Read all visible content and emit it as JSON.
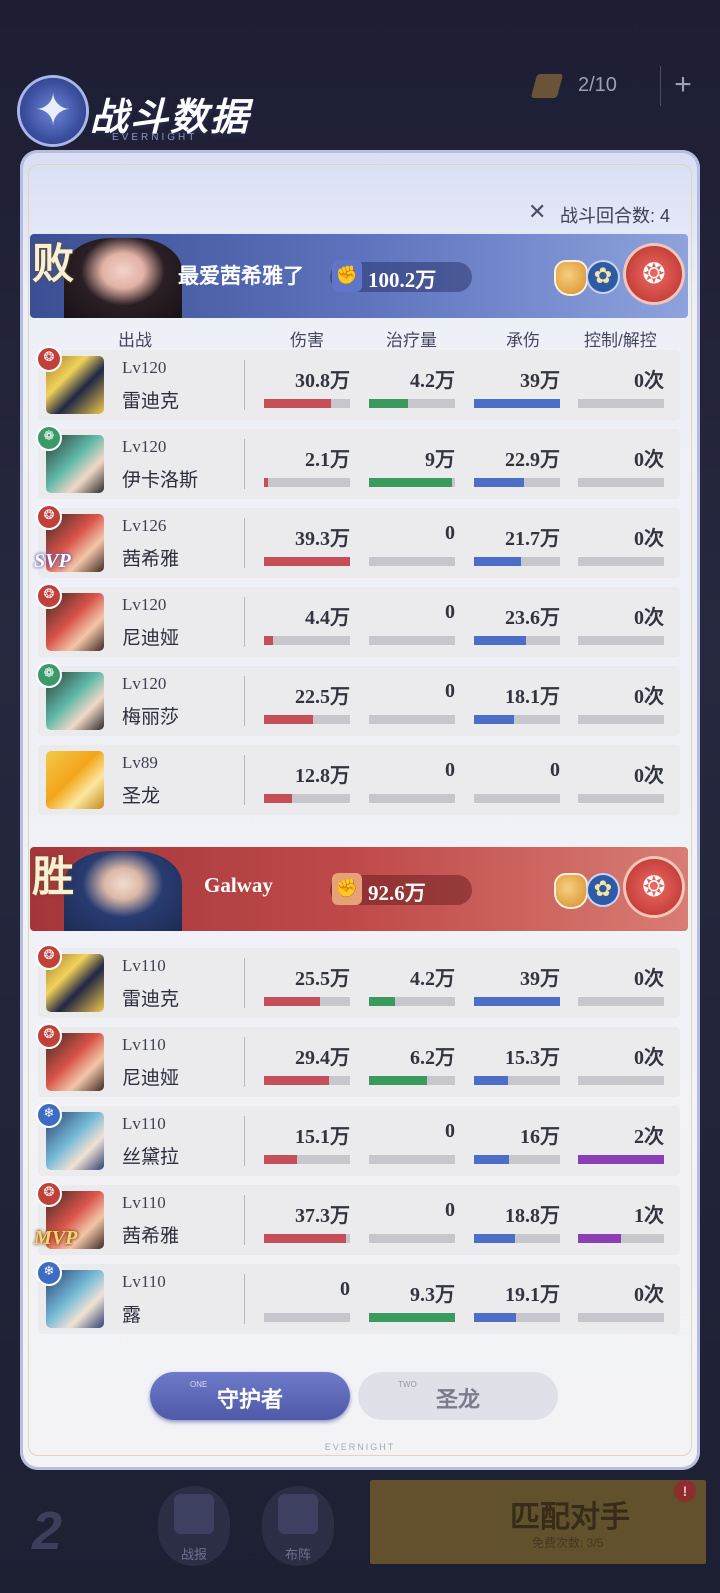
{
  "topbar": {
    "ticket_count": "2/10",
    "plus": "+"
  },
  "header": {
    "title": "战斗数据",
    "brand": "EVERNIGHT",
    "rounds_label": "战斗回合数: 4",
    "rounds_icon": "✕"
  },
  "emblem_glyph": "✦",
  "columns": {
    "lineup": "出战",
    "damage": "伤害",
    "heal": "治疗量",
    "tank": "承伤",
    "control": "控制/解控"
  },
  "team_lose": {
    "result": "败",
    "name": "最爱茜希雅了",
    "power": "100.2万",
    "power_icon": "✊",
    "flower": "✿",
    "faction": "❂"
  },
  "team_win": {
    "result": "胜",
    "name": "Galway",
    "power": "92.6万",
    "power_icon": "✊",
    "flower": "✿",
    "faction": "❂"
  },
  "rows_lose": [
    {
      "faction": "fire",
      "faction_glyph": "❂",
      "badge": "",
      "lv": "Lv120",
      "name": "雷迪克",
      "damage": "30.8万",
      "damage_pct": 78,
      "heal": "4.2万",
      "heal_pct": 45,
      "tank": "39万",
      "tank_pct": 100,
      "control": "0次",
      "control_pct": 0
    },
    {
      "faction": "wind",
      "faction_glyph": "❁",
      "badge": "",
      "lv": "Lv120",
      "name": "伊卡洛斯",
      "damage": "2.1万",
      "damage_pct": 5,
      "heal": "9万",
      "heal_pct": 97,
      "tank": "22.9万",
      "tank_pct": 58,
      "control": "0次",
      "control_pct": 0
    },
    {
      "faction": "fire",
      "faction_glyph": "❂",
      "badge": "SVP",
      "lv": "Lv126",
      "name": "茜希雅",
      "damage": "39.3万",
      "damage_pct": 100,
      "heal": "0",
      "heal_pct": 0,
      "tank": "21.7万",
      "tank_pct": 55,
      "control": "0次",
      "control_pct": 0
    },
    {
      "faction": "fire",
      "faction_glyph": "❂",
      "badge": "",
      "lv": "Lv120",
      "name": "尼迪娅",
      "damage": "4.4万",
      "damage_pct": 11,
      "heal": "0",
      "heal_pct": 0,
      "tank": "23.6万",
      "tank_pct": 60,
      "control": "0次",
      "control_pct": 0
    },
    {
      "faction": "wind",
      "faction_glyph": "❁",
      "badge": "",
      "lv": "Lv120",
      "name": "梅丽莎",
      "damage": "22.5万",
      "damage_pct": 57,
      "heal": "0",
      "heal_pct": 0,
      "tank": "18.1万",
      "tank_pct": 46,
      "control": "0次",
      "control_pct": 0
    },
    {
      "faction": "none",
      "faction_glyph": "",
      "badge": "",
      "lv": "Lv89",
      "name": "圣龙",
      "damage": "12.8万",
      "damage_pct": 33,
      "heal": "0",
      "heal_pct": 0,
      "tank": "0",
      "tank_pct": 0,
      "control": "0次",
      "control_pct": 0
    }
  ],
  "rows_win": [
    {
      "faction": "fire",
      "faction_glyph": "❂",
      "badge": "",
      "lv": "Lv110",
      "name": "雷迪克",
      "damage": "25.5万",
      "damage_pct": 65,
      "heal": "4.2万",
      "heal_pct": 30,
      "tank": "39万",
      "tank_pct": 100,
      "control": "0次",
      "control_pct": 0
    },
    {
      "faction": "fire",
      "faction_glyph": "❂",
      "badge": "",
      "lv": "Lv110",
      "name": "尼迪娅",
      "damage": "29.4万",
      "damage_pct": 75,
      "heal": "6.2万",
      "heal_pct": 67,
      "tank": "15.3万",
      "tank_pct": 39,
      "control": "0次",
      "control_pct": 0
    },
    {
      "faction": "water",
      "faction_glyph": "❄",
      "badge": "",
      "lv": "Lv110",
      "name": "丝黛拉",
      "damage": "15.1万",
      "damage_pct": 38,
      "heal": "0",
      "heal_pct": 0,
      "tank": "16万",
      "tank_pct": 41,
      "control": "2次",
      "control_pct": 100
    },
    {
      "faction": "fire",
      "faction_glyph": "❂",
      "badge": "MVP",
      "lv": "Lv110",
      "name": "茜希雅",
      "damage": "37.3万",
      "damage_pct": 95,
      "heal": "0",
      "heal_pct": 0,
      "tank": "18.8万",
      "tank_pct": 48,
      "control": "1次",
      "control_pct": 50
    },
    {
      "faction": "water",
      "faction_glyph": "❄",
      "badge": "",
      "lv": "Lv110",
      "name": "露",
      "damage": "0",
      "damage_pct": 0,
      "heal": "9.3万",
      "heal_pct": 100,
      "tank": "19.1万",
      "tank_pct": 49,
      "control": "0次",
      "control_pct": 0
    }
  ],
  "tabs": [
    {
      "num": "ONE",
      "label": "守护者",
      "active": true
    },
    {
      "num": "TWO",
      "label": "圣龙",
      "active": false
    }
  ],
  "footer_brand": "EVERNIGHT",
  "bottom": {
    "logo": "2",
    "nav_battle": "战报",
    "nav_lineup": "布阵",
    "match": "匹配对手",
    "match_sub": "免费次数: 3/5",
    "alert": "!"
  }
}
